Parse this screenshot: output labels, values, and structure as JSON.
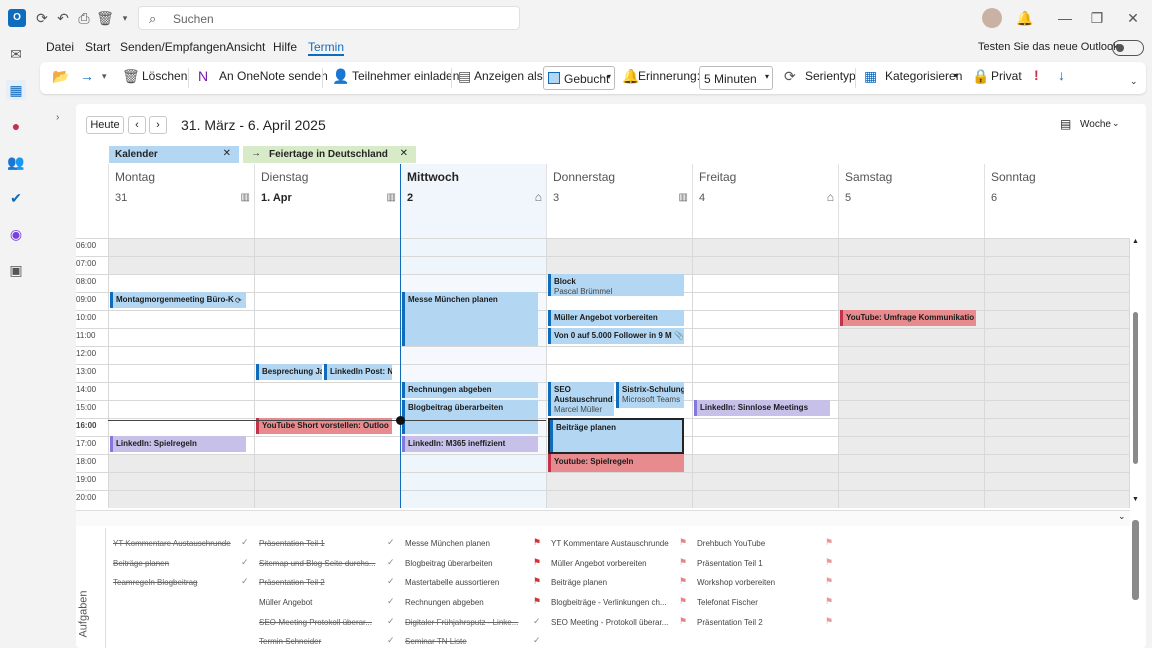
{
  "titlebar": {
    "search_placeholder": "Suchen"
  },
  "menu": {
    "items": [
      "Datei",
      "Start",
      "Senden/Empfangen",
      "Ansicht",
      "Hilfe",
      "Termin"
    ],
    "new_outlook": "Testen Sie das neue Outlook"
  },
  "ribbon": {
    "delete": "Löschen",
    "onenote": "An OneNote senden",
    "invite": "Teilnehmer einladen",
    "show_as_label": "Anzeigen als:",
    "show_as_value": "Gebucht",
    "reminder_label": "Erinnerung:",
    "reminder_value": "5 Minuten",
    "series": "Serientyp",
    "categorize": "Kategorisieren",
    "private": "Privat"
  },
  "calendar": {
    "today_button": "Heute",
    "range": "31. März - 6. April 2025",
    "view": "Woche",
    "tabs": [
      "Kalender",
      "Feiertage in Deutschland"
    ],
    "days": [
      {
        "name": "Montag",
        "num": "31"
      },
      {
        "name": "Dienstag",
        "num": "1. Apr"
      },
      {
        "name": "Mittwoch",
        "num": "2"
      },
      {
        "name": "Donnerstag",
        "num": "3"
      },
      {
        "name": "Freitag",
        "num": "4"
      },
      {
        "name": "Samstag",
        "num": "5"
      },
      {
        "name": "Sonntag",
        "num": "6"
      }
    ],
    "hours": [
      "06:00",
      "07:00",
      "08:00",
      "09:00",
      "10:00",
      "11:00",
      "12:00",
      "13:00",
      "14:00",
      "15:00",
      "16:00",
      "17:00",
      "18:00",
      "19:00",
      "20:00"
    ],
    "events": {
      "e1": "Montagmorgenmeeting Büro-K",
      "e2": "Messe München planen",
      "e3t": "Block",
      "e3s": "Pascal Brümmel",
      "e4": "Müller Angebot vorbereiten",
      "e5": "Von 0 auf 5.000 Follower in 9 M",
      "e6": "YouTube: Umfrage Kommunikatio",
      "e7": "Besprechung Ja",
      "e8": "LinkedIn Post: N",
      "e9": "Rechnungen abgeben",
      "e10": "Blogbeitrag überarbeiten",
      "e11t": "SEO Austauschrund",
      "e11s": "Marcel Müller",
      "e12t": "Sistrix-Schulung",
      "e12s": "Microsoft Teams",
      "e13": "LinkedIn: Sinnlose Meetings",
      "e14": "YouTube Short vorstellen: Outloo",
      "e15": "Beiträge planen",
      "e16": "LinkedIn: Spielregeln",
      "e17": "LinkedIn: M365 ineffizient",
      "e18": "Youtube: Spielregeln"
    },
    "tasks_label": "Aufgaben",
    "tasks": {
      "c1": [
        "YT Kommentare Austauschrunde",
        "Beiträge planen",
        "Teamregeln Blogbeitrag"
      ],
      "c2": [
        "Präsentation Teil 1",
        "Sitemap und Blog Seite durchs...",
        "Präsentation Teil 2",
        "Müller Angebot",
        "SEO-Meeting Protokoll überar...",
        "Termin Schneider"
      ],
      "c3": [
        "Messe München planen",
        "Blogbeitrag überarbeiten",
        "Mastertabelle aussortieren",
        "Rechnungen abgeben",
        "Digitaler Frühjahrsputz - Linke...",
        "Seminar TN Liste"
      ],
      "c4": [
        "YT Kommentare Austauschrunde",
        "Müller Angebot vorbereiten",
        "Beiträge planen",
        "Blogbeiträge - Verlinkungen ch...",
        "SEO Meeting - Protokoll überar..."
      ],
      "c5": [
        "Drehbuch YouTube",
        "Präsentation Teil 1",
        "Workshop vorbereiten",
        "Telefonat Fischer",
        "Präsentation Teil 2"
      ]
    }
  }
}
